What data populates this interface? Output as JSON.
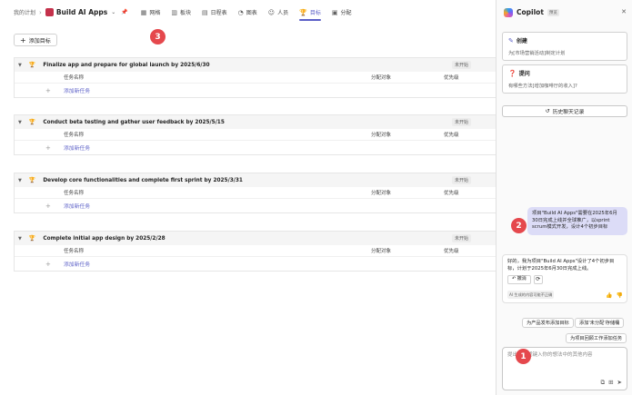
{
  "breadcrumb": {
    "root": "我的计划",
    "project": "Build AI Apps"
  },
  "tabs": [
    {
      "icon": "grid-icon",
      "glyph": "▦",
      "label": "网格",
      "active": false
    },
    {
      "icon": "board-icon",
      "glyph": "▥",
      "label": "板块",
      "active": false
    },
    {
      "icon": "calendar-icon",
      "glyph": "▤",
      "label": "日程表",
      "active": false
    },
    {
      "icon": "chart-icon",
      "glyph": "◔",
      "label": "图表",
      "active": false
    },
    {
      "icon": "people-icon",
      "glyph": "☺",
      "label": "人员",
      "active": false
    },
    {
      "icon": "trophy-icon",
      "glyph": "🏆",
      "label": "目标",
      "active": true
    },
    {
      "icon": "assign-icon",
      "glyph": "▣",
      "label": "分配",
      "active": false
    }
  ],
  "add_goal": "添加目标",
  "goals": [
    {
      "title": "Finalize app and prepare for global launch by 2025/6/30",
      "status": "未开始"
    },
    {
      "title": "Conduct beta testing and gather user feedback by 2025/5/15",
      "status": "未开始"
    },
    {
      "title": "Develop core functionalities and complete first sprint by 2025/3/31",
      "status": "未开始"
    },
    {
      "title": "Complete initial app design by 2025/2/28",
      "status": "未开始"
    }
  ],
  "columns": {
    "task": "任务名称",
    "assign": "分配对象",
    "priority": "优先级"
  },
  "add_task": "添加新任务",
  "badges": {
    "one": "1",
    "two": "2",
    "three": "3"
  },
  "copilot": {
    "title": "Copilot",
    "tag": "预览",
    "create_title": "创建",
    "create_desc": "为[市场营销活动]制定计划",
    "ask_title": "提问",
    "ask_desc": "有哪些方法[增加咖啡厅的收入]?",
    "history": "历史聊天记录",
    "user_message": "项目\"Build AI Apps\"需要在2025年6月30日完成上线并全球推广，以sprint scrum模式开发，设计4个初步目标",
    "bot_message": "好的，我为项目\"Build AI Apps\"设计了4个初步目标，计划于2025年6月30日完成上线。",
    "undo": "撤消",
    "ai_note": "AI 生成的内容可能不正确",
    "suggestions": [
      "为产品发布添加目标",
      "添加'未分配'存储桶",
      "为项目回顾工作添加任务"
    ],
    "input_placeholder": "提出问题或键入你的想法中的其他内容"
  }
}
